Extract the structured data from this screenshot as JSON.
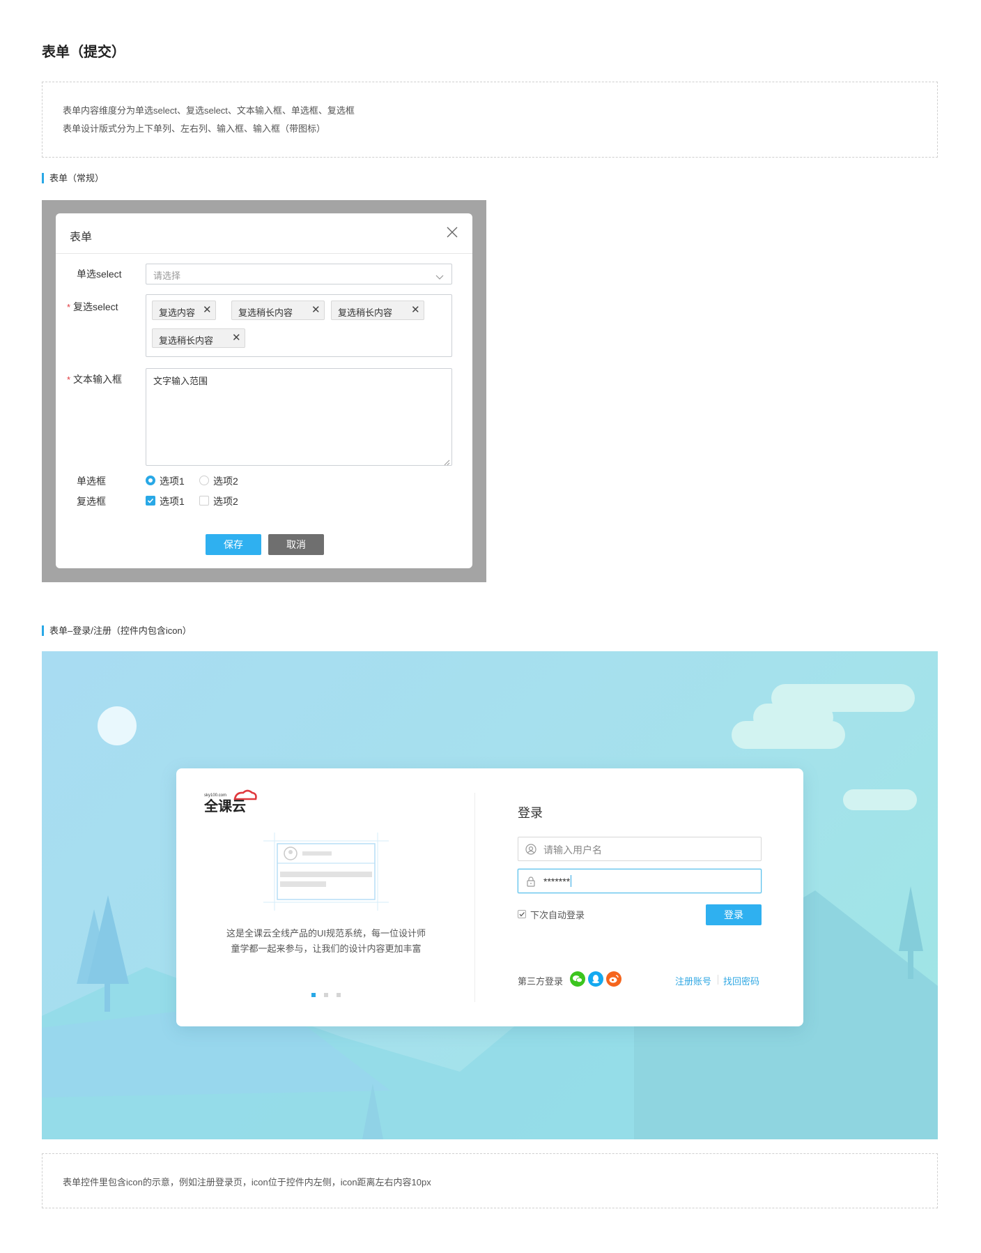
{
  "page": {
    "title": "表单（提交）",
    "notes": [
      "表单内容维度分为单选select、复选select、文本输入框、单选框、复选框",
      "表单设计版式分为上下单列、左右列、输入框、输入框（带图标）"
    ]
  },
  "section_regular": {
    "title": "表单（常规）"
  },
  "modal": {
    "title": "表单",
    "single_select": {
      "label": "单选select",
      "placeholder": "请选择"
    },
    "multi_select": {
      "label": "复选select",
      "required_mark": "*",
      "tags": [
        "复选内容",
        "复选稍长内容",
        "复选稍长内容",
        "复选稍长内容"
      ],
      "tag_remove": "✕"
    },
    "textarea": {
      "label": "文本输入框",
      "required_mark": "*",
      "value": "文字输入范围"
    },
    "radio": {
      "label": "单选框",
      "options": [
        "选项1",
        "选项2"
      ],
      "selected": "选项1"
    },
    "checkbox": {
      "label": "复选框",
      "options": [
        "选项1",
        "选项2"
      ],
      "checked": [
        "选项1"
      ]
    },
    "save_label": "保存",
    "cancel_label": "取消"
  },
  "section_login": {
    "title": "表单–登录/注册（控件内包含icon）"
  },
  "login_card": {
    "logo_text": "全课云",
    "logo_small": "sky100.com",
    "description_line1": "这是全课云全线产品的UI规范系统，每一位设计师",
    "description_line2": "童学都一起来参与，让我们的设计内容更加丰富",
    "carousel": {
      "count": 3,
      "active": 1
    },
    "form_title": "登录",
    "username_placeholder": "请输入用户名",
    "password_value": "*******",
    "remember_label": "下次自动登录",
    "login_button": "登录",
    "third_party_label": "第三方登录",
    "social_icons": [
      "wechat-icon",
      "qq-icon",
      "weibo-icon"
    ],
    "register_link": "注册账号",
    "forgot_link": "找回密码"
  },
  "footer_note": "表单控件里包含icon的示意，例如注册登录页，icon位于控件内左侧，icon距离左右内容10px",
  "colors": {
    "accent": "#2fb0f0",
    "required": "#e0393e",
    "cancel": "#6f6f6f",
    "wechat": "#3cc51f",
    "qq": "#14a9f0",
    "weibo": "#f5651d",
    "logo_red": "#e0393e"
  }
}
